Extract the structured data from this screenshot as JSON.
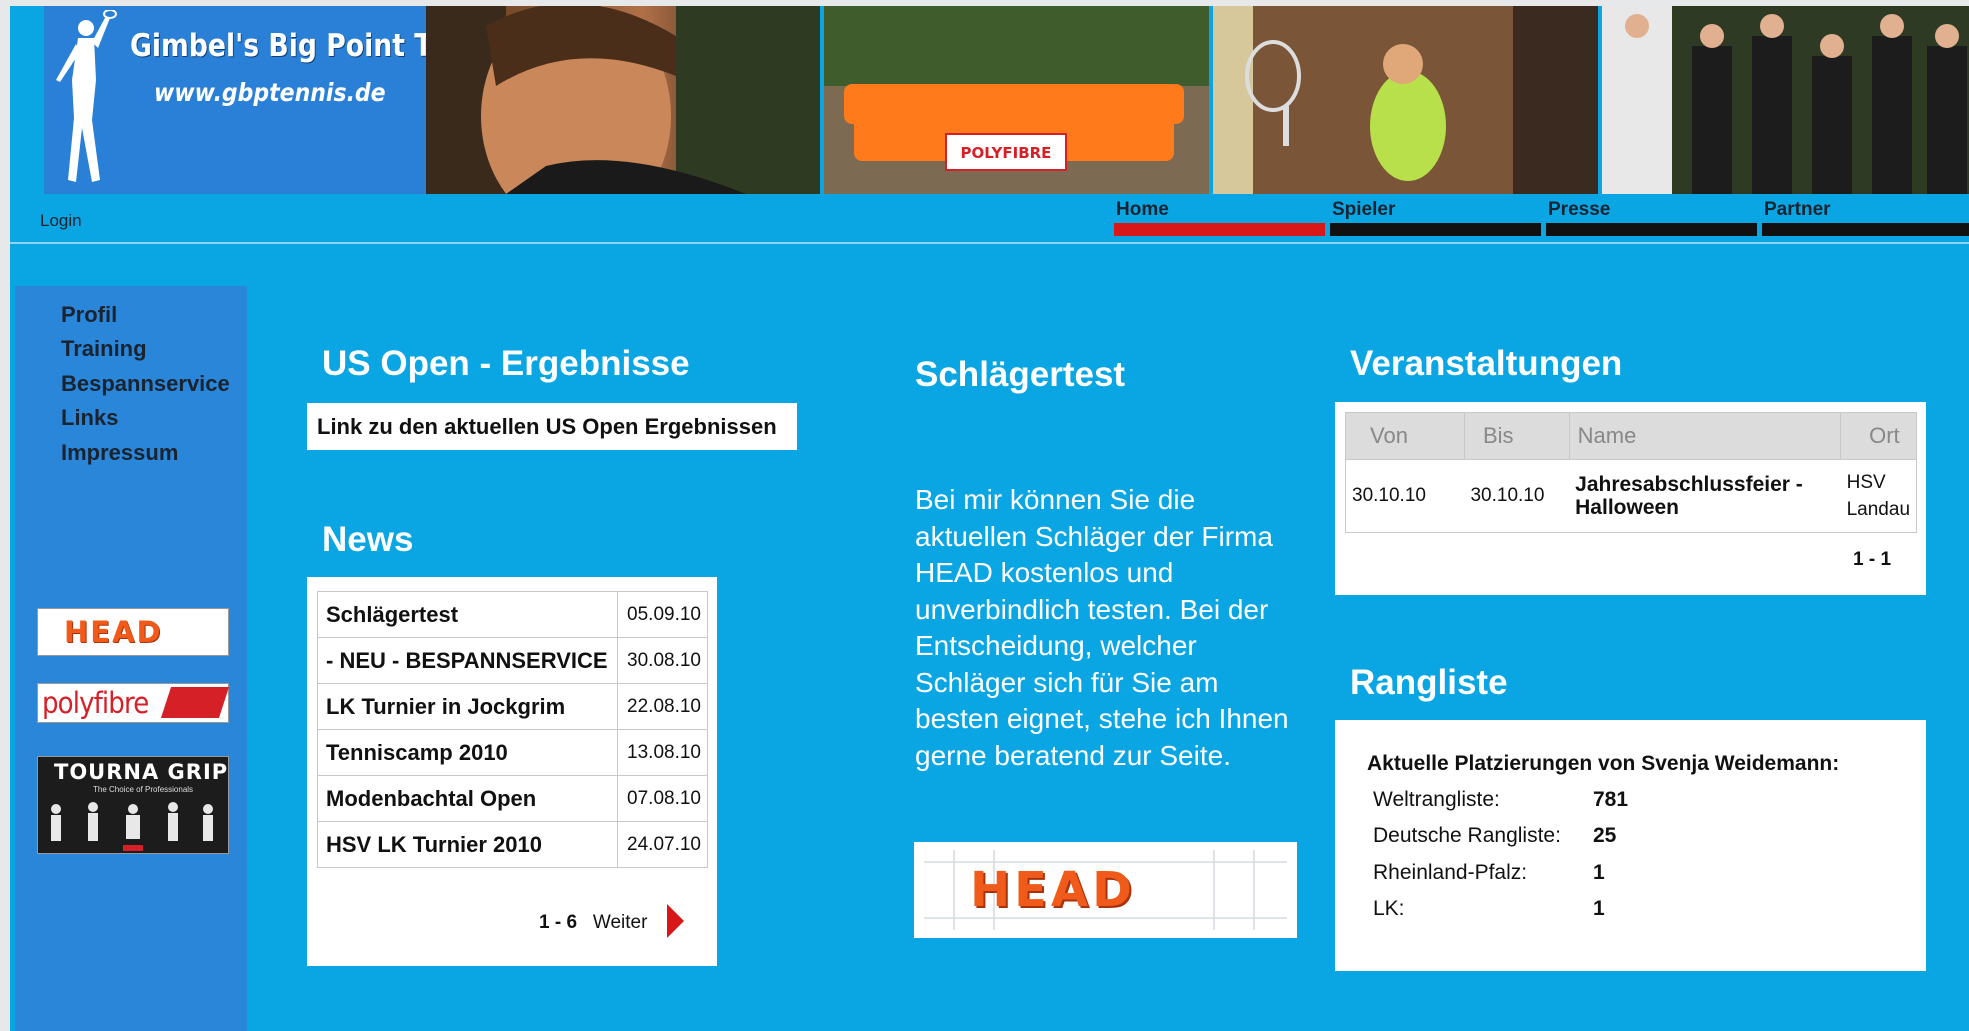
{
  "header": {
    "logo_title": "Gimbel's Big Point Tennis",
    "logo_url": "www.gbptennis.de",
    "login_label": "Login",
    "nav": [
      {
        "label": "Home",
        "active": true
      },
      {
        "label": "Spieler",
        "active": false
      },
      {
        "label": "Presse",
        "active": false
      },
      {
        "label": "Partner",
        "active": false
      }
    ],
    "banner_photo_text": "POLYFIBRE"
  },
  "sidebar": {
    "links": [
      "Profil",
      "Training",
      "Bespannservice",
      "Links",
      "Impressum"
    ],
    "sponsors": {
      "head": "HEAD",
      "polyfibre": "polyfibre",
      "tourna": "TOURNA GRIP",
      "tourna_tagline": "The Choice of Professionals"
    }
  },
  "usopen": {
    "heading": "US Open - Ergebnisse",
    "link_label": "Link zu den aktuellen US Open Ergebnissen"
  },
  "news": {
    "heading": "News",
    "items": [
      {
        "title": "Schlägertest",
        "date": "05.09.10"
      },
      {
        "title": "- NEU - BESPANNSERVICE",
        "date": "30.08.10"
      },
      {
        "title": "LK Turnier in Jockgrim",
        "date": "22.08.10"
      },
      {
        "title": "Tenniscamp 2010",
        "date": "13.08.10"
      },
      {
        "title": "Modenbachtal Open",
        "date": "07.08.10"
      },
      {
        "title": "HSV LK Turnier 2010",
        "date": "24.07.10"
      }
    ],
    "pager_range": "1 - 6",
    "pager_next": "Weiter"
  },
  "schlaegertest": {
    "heading": "Schlägertest",
    "text": "Bei mir können Sie die aktuellen Schläger der Firma HEAD kostenlos und unverbindlich testen. Bei der Entscheidung, welcher Schläger sich für Sie am besten eignet, stehe ich Ihnen gerne beratend zur Seite.",
    "image_text": "HEAD"
  },
  "events": {
    "heading": "Veranstaltungen",
    "columns": [
      "Von",
      "Bis",
      "Name",
      "Ort"
    ],
    "rows": [
      {
        "von": "30.10.10",
        "bis": "30.10.10",
        "name": "Jahresabschlussfeier - Halloween",
        "ort": "HSV Landau"
      }
    ],
    "pager_range": "1 - 1"
  },
  "ranking": {
    "heading": "Rangliste",
    "title": "Aktuelle Platzierungen von Svenja Weidemann:",
    "rows": [
      {
        "label": "Weltrangliste:",
        "value": "781"
      },
      {
        "label": "Deutsche Rangliste:",
        "value": "25"
      },
      {
        "label": "Rheinland-Pfalz:",
        "value": "1"
      },
      {
        "label": "LK:",
        "value": "1"
      }
    ]
  },
  "colors": {
    "page_background": "#0aa6e3",
    "sidebar_background": "#2a86d9",
    "nav_active": "#d81818",
    "head_brand": "#f05a1a",
    "polyfibre_brand": "#d62028"
  }
}
